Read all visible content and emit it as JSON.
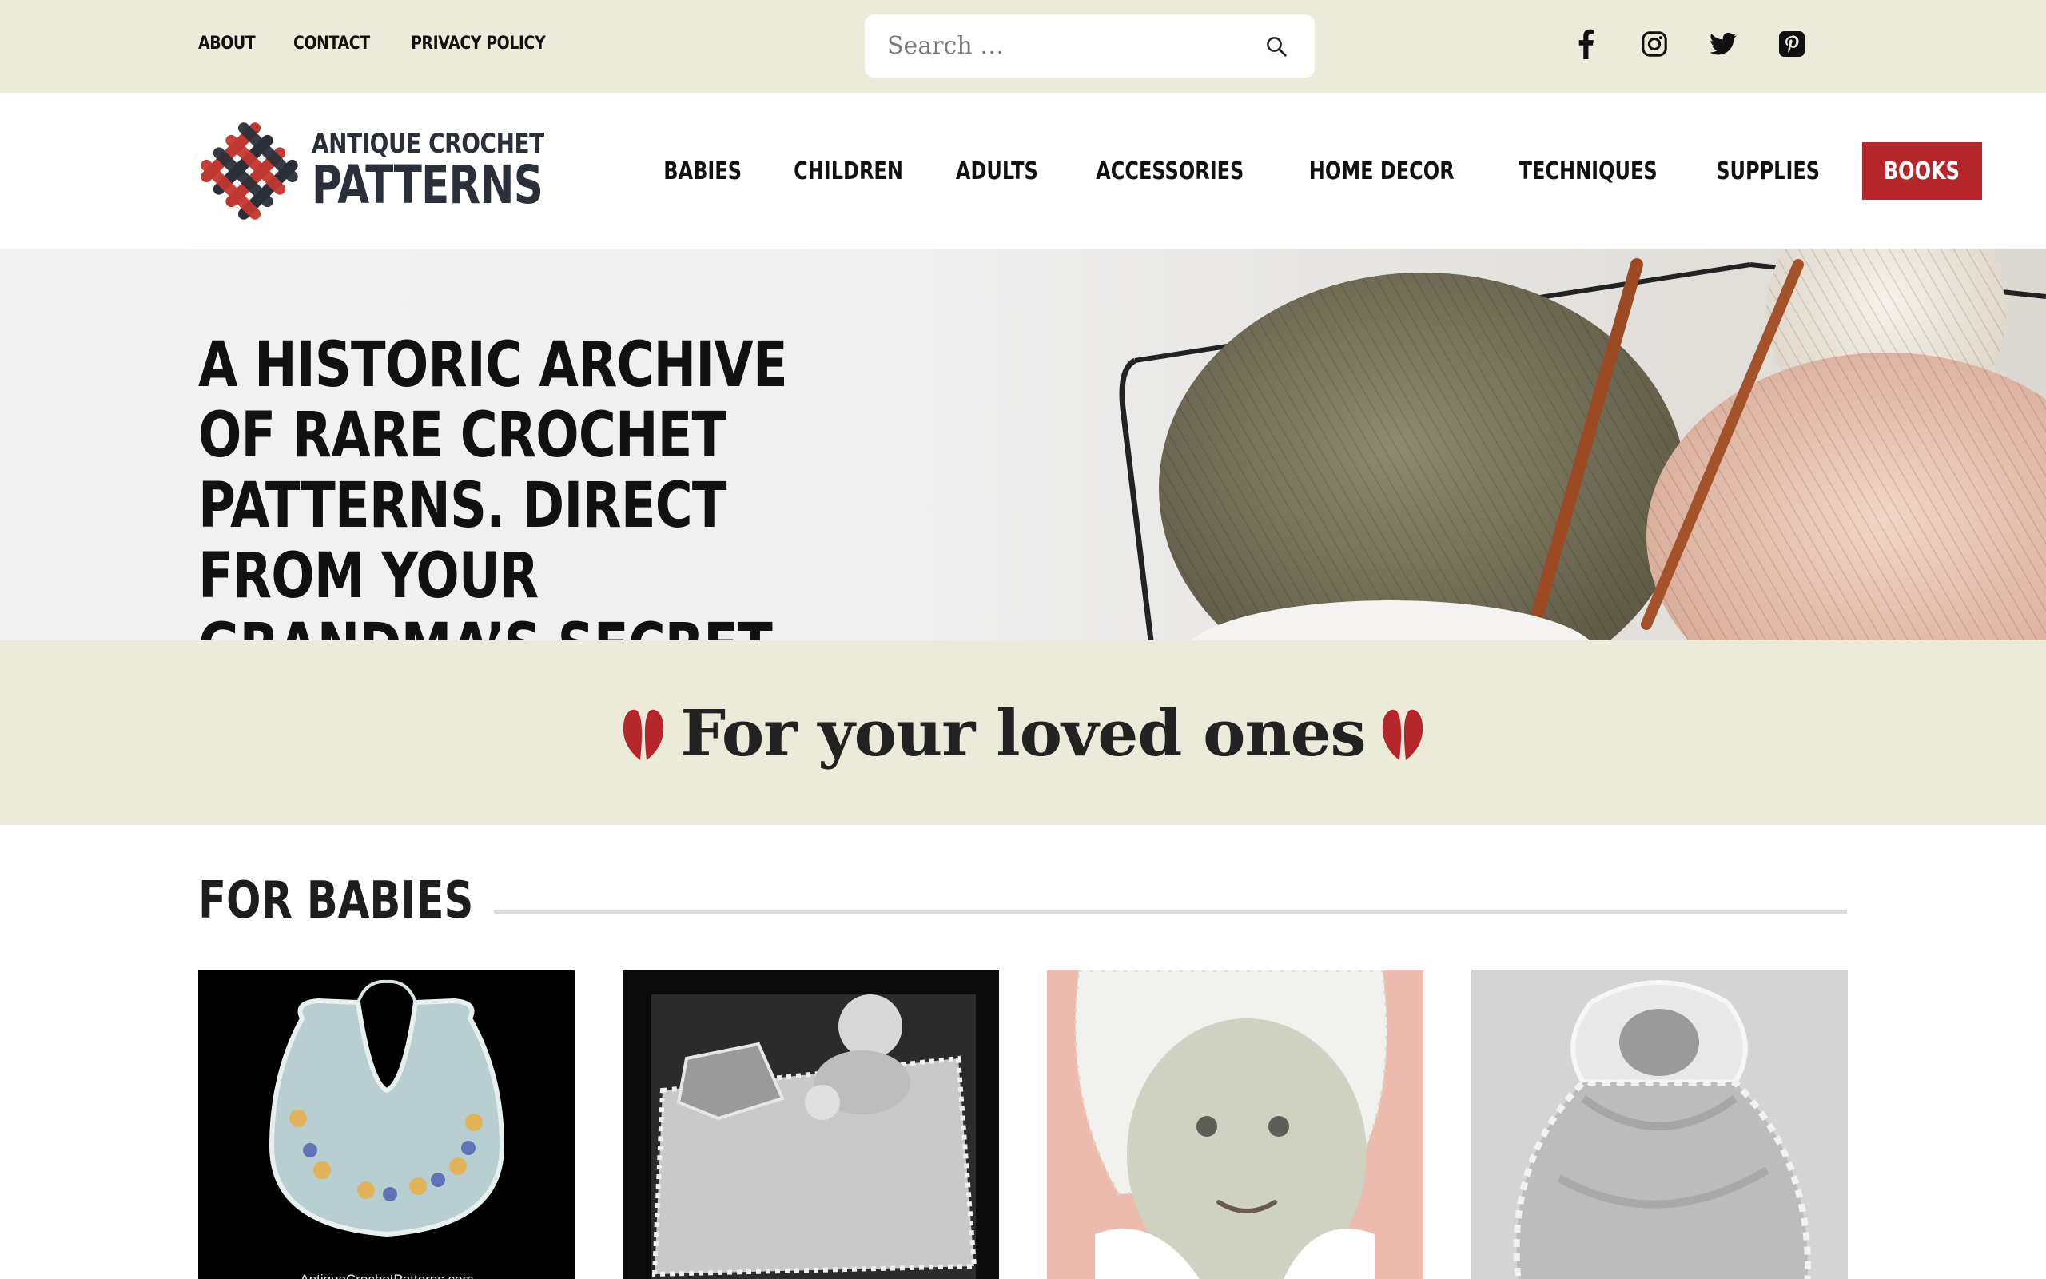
{
  "topbar": {
    "links": [
      "ABOUT",
      "CONTACT",
      "PRIVACY POLICY"
    ],
    "search": {
      "placeholder": "Search …"
    },
    "socials": [
      "facebook-icon",
      "instagram-icon",
      "twitter-icon",
      "pinterest-icon"
    ]
  },
  "header": {
    "logo": {
      "line1": "ANTIQUE CROCHET",
      "line2": "PATTERNS"
    },
    "nav": [
      "BABIES",
      "CHILDREN",
      "ADULTS",
      "ACCESSORIES",
      "HOME DECOR",
      "TECHNIQUES",
      "SUPPLIES"
    ],
    "books_label": "BOOKS"
  },
  "hero": {
    "headline": "A HISTORIC ARCHIVE OF RARE CROCHET PATTERNS. DIRECT FROM YOUR GRANDMA’S SECRET VAULT."
  },
  "band": {
    "tagline": "For your loved ones"
  },
  "section": {
    "title": "FOR BABIES",
    "cards": [
      {
        "caption": "AntiqueCrochetPatterns.com"
      },
      {
        "caption": ""
      },
      {
        "caption": ""
      },
      {
        "caption": ""
      }
    ]
  },
  "colors": {
    "cream": "#ecead8",
    "accent_red": "#b5262a",
    "navy": "#2a2f3a"
  }
}
